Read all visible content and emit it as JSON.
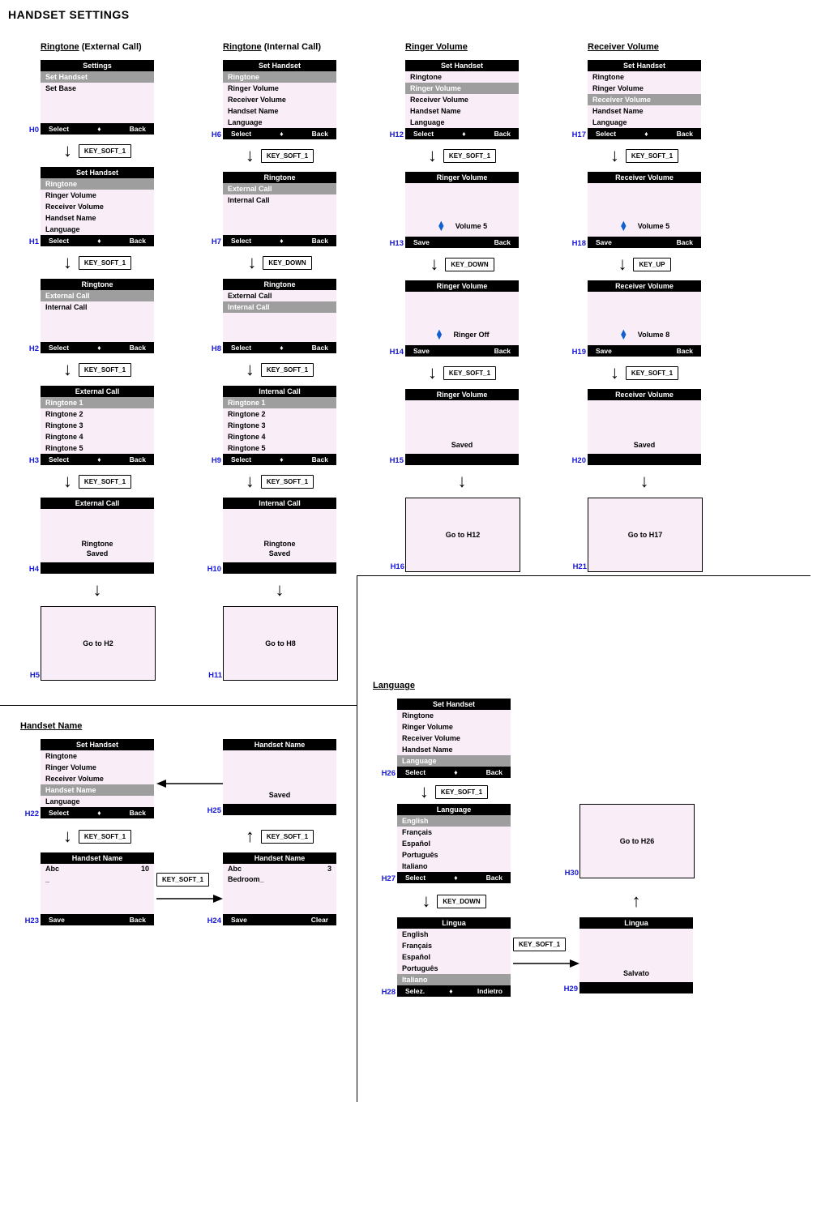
{
  "page_title": "HANDSET SETTINGS",
  "section_titles": {
    "ringtone_ext": {
      "u1": "Ringtone",
      "rest": " (External Call)"
    },
    "ringtone_int": {
      "u1": "Ringtone",
      "rest": " (Internal Call)"
    },
    "ringer_vol": {
      "u1": "Ringer Volume",
      "rest": ""
    },
    "receiver_vol": {
      "u1": "Receiver Volume",
      "rest": ""
    },
    "handset_name": {
      "u1": "Handset Name",
      "rest": ""
    },
    "language": {
      "u1": "Language",
      "rest": ""
    }
  },
  "keys": {
    "soft1": "KEY_SOFT_1",
    "down": "KEY_DOWN",
    "up": "KEY_UP"
  },
  "softkeys": {
    "select": "Select",
    "back": "Back",
    "save": "Save",
    "clear": "Clear",
    "selez": "Selez.",
    "indietro": "Indietro"
  },
  "menu_items": {
    "ringtone": "Ringtone",
    "ringer_vol": "Ringer Volume",
    "receiver_vol": "Receiver Volume",
    "handset_name": "Handset Name",
    "language": "Language",
    "set_handset": "Set Handset",
    "set_base": "Set Base",
    "ext_call": "External Call",
    "int_call": "Internal Call",
    "r1": "Ringtone 1",
    "r2": "Ringtone 2",
    "r3": "Ringtone 3",
    "r4": "Ringtone 4",
    "r5": "Ringtone 5",
    "en": "English",
    "fr": "Français",
    "es": "Español",
    "pt": "Português",
    "it": "Italiano"
  },
  "screens": {
    "H0": {
      "id": "H0",
      "title": "Settings"
    },
    "H1": {
      "id": "H1",
      "title": "Set Handset"
    },
    "H2": {
      "id": "H2",
      "title": "Ringtone"
    },
    "H3": {
      "id": "H3",
      "title": "External Call"
    },
    "H4": {
      "id": "H4",
      "title": "External Call",
      "msg1": "Ringtone",
      "msg2": "Saved"
    },
    "H5": {
      "id": "H5",
      "goto": "Go to H2"
    },
    "H6": {
      "id": "H6",
      "title": "Set Handset"
    },
    "H7": {
      "id": "H7",
      "title": "Ringtone"
    },
    "H8": {
      "id": "H8",
      "title": "Ringtone"
    },
    "H9": {
      "id": "H9",
      "title": "Internal Call"
    },
    "H10": {
      "id": "H10",
      "title": "Internal Call",
      "msg1": "Ringtone",
      "msg2": "Saved"
    },
    "H11": {
      "id": "H11",
      "goto": "Go to H8"
    },
    "H12": {
      "id": "H12",
      "title": "Set Handset"
    },
    "H13": {
      "id": "H13",
      "title": "Ringer Volume",
      "vol": "Volume 5"
    },
    "H14": {
      "id": "H14",
      "title": "Ringer Volume",
      "vol": "Ringer Off"
    },
    "H15": {
      "id": "H15",
      "title": "Ringer Volume",
      "msg": "Saved"
    },
    "H16": {
      "id": "H16",
      "goto": "Go to H12"
    },
    "H17": {
      "id": "H17",
      "title": "Set Handset"
    },
    "H18": {
      "id": "H18",
      "title": "Receiver Volume",
      "vol": "Volume 5"
    },
    "H19": {
      "id": "H19",
      "title": "Receiver Volume",
      "vol": "Volume 8"
    },
    "H20": {
      "id": "H20",
      "title": "Receiver Volume",
      "msg": "Saved"
    },
    "H21": {
      "id": "H21",
      "goto": "Go to H17"
    },
    "H22": {
      "id": "H22",
      "title": "Set Handset"
    },
    "H23": {
      "id": "H23",
      "title": "Handset Name",
      "mode": "Abc",
      "count": "10",
      "text": "_"
    },
    "H24": {
      "id": "H24",
      "title": "Handset Name",
      "mode": "Abc",
      "count": "3",
      "text": "Bedroom_"
    },
    "H25": {
      "id": "H25",
      "title": "Handset Name",
      "msg": "Saved"
    },
    "H26": {
      "id": "H26",
      "title": "Set Handset"
    },
    "H27": {
      "id": "H27",
      "title": "Language"
    },
    "H28": {
      "id": "H28",
      "title": "Lingua"
    },
    "H29": {
      "id": "H29",
      "title": "Lingua",
      "msg": "Salvato"
    },
    "H30": {
      "id": "H30",
      "goto": "Go to H26"
    }
  }
}
